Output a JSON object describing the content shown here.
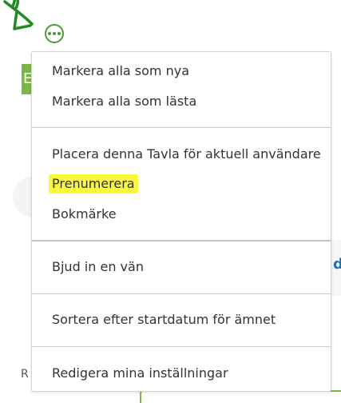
{
  "background": {
    "left_tab_letter": "E",
    "right_edge_letter": "d",
    "left_edge_letter": "R"
  },
  "options_button": {
    "icon": "more-horizontal-icon",
    "accent_color": "#4b9a3a"
  },
  "annotation": {
    "arrow_color": "#1e8c1e",
    "highlight_color": "#fbf73a"
  },
  "menu": {
    "items": [
      {
        "label": "Markera alla som nya"
      },
      {
        "label": "Markera alla som lästa"
      },
      {
        "label": "Placera denna Tavla för aktuell användare"
      },
      {
        "label": "Prenumerera",
        "highlighted": true
      },
      {
        "label": "Bokmärke"
      },
      {
        "label": "Bjud in en vän"
      },
      {
        "label": "Sortera efter startdatum för ämnet"
      },
      {
        "label": "Redigera mina inställningar"
      }
    ]
  }
}
